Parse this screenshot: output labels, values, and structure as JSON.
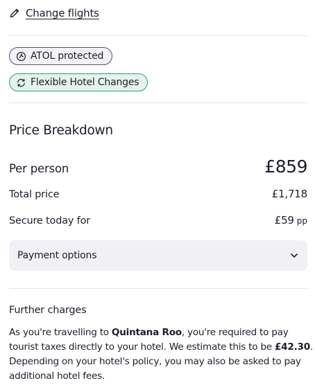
{
  "change_flights": {
    "label": "Change flights",
    "icon": "pencil-icon"
  },
  "badges": [
    {
      "label": "ATOL protected",
      "icon": "atol-icon",
      "border_color": "#50506a",
      "bg_color": "#f3f3f6"
    },
    {
      "label": "Flexible Hotel Changes",
      "icon": "flexible-change-icon",
      "border_color": "#2e9a78",
      "bg_color": "#e2f4ec"
    }
  ],
  "price_breakdown": {
    "title": "Price Breakdown",
    "per_person": {
      "label": "Per person",
      "value": "£859"
    },
    "total_price": {
      "label": "Total price",
      "value": "£1,718"
    },
    "secure_today": {
      "label": "Secure today for",
      "value": "£59",
      "suffix": "pp"
    }
  },
  "payment_options": {
    "label": "Payment options",
    "icon": "chevron-down-icon"
  },
  "further_charges": {
    "title": "Further charges",
    "text_1": "As you're travelling to ",
    "destination": "Quintana Roo",
    "text_2": ", you're required to pay tourist taxes directly to your hotel. We estimate this to be ",
    "amount": "£42.30",
    "text_3": ". Depending on your hotel's policy, you may also be asked to pay additional hotel fees."
  }
}
